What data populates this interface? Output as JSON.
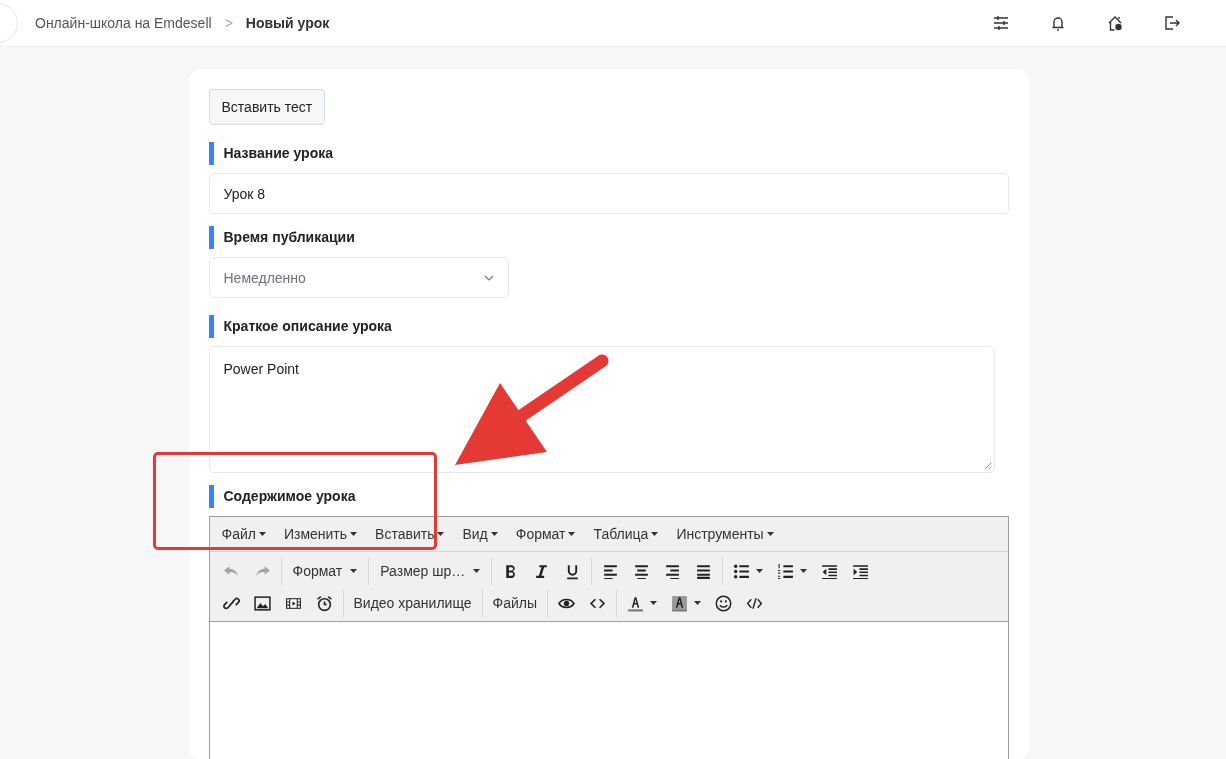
{
  "breadcrumb": {
    "parent": "Онлайн-школа на Emdesell",
    "separator": ">",
    "current": "Новый урок"
  },
  "header_icons": [
    {
      "kind": "sliders"
    },
    {
      "kind": "bell"
    },
    {
      "kind": "home"
    },
    {
      "kind": "logout"
    }
  ],
  "insert_test_button": "Вставить тест",
  "fields": [
    {
      "kind": "input",
      "label": "Название урока",
      "value": "Урок 8"
    },
    {
      "kind": "select",
      "label": "Время публикации",
      "value": "Немедленно"
    },
    {
      "kind": "textarea",
      "label": "Краткое описание урока",
      "value": "Power Point"
    }
  ],
  "editor": {
    "label": "Содержимое урока",
    "menu": [
      "Файл",
      "Изменить",
      "Вставить",
      "Вид",
      "Формат",
      "Таблица",
      "Инструменты"
    ],
    "toolbar_rows": [
      [
        [
          {
            "kind": "undo",
            "disabled": true
          },
          {
            "kind": "redo",
            "disabled": true
          }
        ],
        [
          {
            "kind": "dropdown",
            "label": "Формат"
          }
        ],
        [
          {
            "kind": "dropdown",
            "label": "Размер шр…"
          }
        ],
        [
          {
            "kind": "bold",
            "disabled": false
          },
          {
            "kind": "italic",
            "disabled": false
          },
          {
            "kind": "underline",
            "disabled": false
          }
        ],
        [
          {
            "kind": "align-left",
            "disabled": false
          },
          {
            "kind": "align-center",
            "disabled": false
          },
          {
            "kind": "align-right",
            "disabled": false
          },
          {
            "kind": "justify",
            "disabled": false
          }
        ],
        [
          {
            "kind": "bullet-list",
            "disabled": false,
            "caret": true
          },
          {
            "kind": "numbered-list",
            "disabled": false,
            "caret": true
          },
          {
            "kind": "outdent",
            "disabled": false
          },
          {
            "kind": "indent",
            "disabled": false
          }
        ]
      ],
      [
        [
          {
            "kind": "link",
            "disabled": false
          },
          {
            "kind": "image",
            "disabled": false
          },
          {
            "kind": "film",
            "disabled": false
          },
          {
            "kind": "alarm",
            "disabled": false
          }
        ],
        [
          {
            "kind": "text",
            "label": "Видео хранилище"
          }
        ],
        [
          {
            "kind": "text",
            "label": "Файлы"
          }
        ],
        [
          {
            "kind": "eye",
            "disabled": false
          },
          {
            "kind": "code",
            "disabled": false
          }
        ],
        [
          {
            "kind": "text-color",
            "disabled": false,
            "caret": true
          },
          {
            "kind": "bg-color",
            "disabled": false,
            "caret": true
          },
          {
            "kind": "emoji",
            "disabled": false
          },
          {
            "kind": "source",
            "disabled": false
          }
        ]
      ]
    ]
  },
  "annotations": {
    "frame": true,
    "arrow": true
  }
}
